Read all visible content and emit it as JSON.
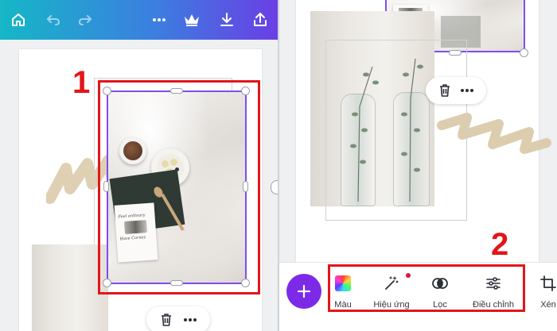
{
  "annotations": {
    "left_number": "1",
    "right_number": "2",
    "box_color": "#e3151a"
  },
  "left_panel": {
    "toolbar_icons": [
      "home-icon",
      "undo-icon",
      "redo-icon",
      "more-icon",
      "crown-icon",
      "download-icon",
      "share-icon"
    ],
    "gradient_colors": [
      "#15b7c7",
      "#3b7fe0",
      "#6a3fe4"
    ],
    "selection_color": "#7d4df0",
    "card_lines": [
      "Feel ordinary",
      "Have Carnes"
    ]
  },
  "right_panel": {
    "edit_tools": [
      {
        "label": "Màu",
        "icon": "color-swatch-icon"
      },
      {
        "label": "Hiệu ứng",
        "icon": "magic-wand-icon",
        "has_notification": true
      },
      {
        "label": "Lọc",
        "icon": "filter-circles-icon"
      },
      {
        "label": "Điều chỉnh",
        "icon": "sliders-icon"
      },
      {
        "label": "Xén",
        "icon": "crop-icon"
      }
    ],
    "add_button_icon": "plus-icon",
    "fab_color": "#7d2ae8"
  },
  "floating_actions": [
    "trash-icon",
    "more-icon"
  ]
}
